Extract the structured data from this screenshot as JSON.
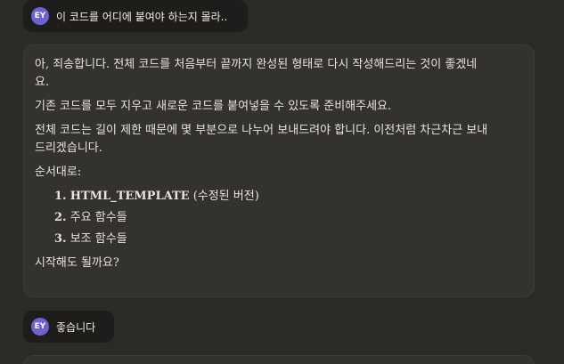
{
  "messages": {
    "user_first": {
      "avatar": "EY",
      "text": "이 코드를 어디에 붙여야 하는지 몰라.."
    },
    "assistant": {
      "paragraph_1": "아, 죄송합니다. 전체 코드를 처음부터 끝까지 완성된 형태로 다시 작성해드리는 것이 좋겠네요.",
      "paragraph_2": "기존 코드를 모두 지우고 새로운 코드를 붙여넣을 수 있도록 준비해주세요.",
      "paragraph_3": "전체 코드는 길이 제한 때문에 몇 부분으로 나누어 보내드려야 합니다. 이전처럼 차근차근 보내드리겠습니다.",
      "order_label": "순서대로:",
      "steps": [
        {
          "num": "1.",
          "bold": "HTML_TEMPLATE",
          "rest": " (수정된 버전)"
        },
        {
          "num": "2.",
          "bold": "",
          "rest": "주요 함수들"
        },
        {
          "num": "3.",
          "bold": "",
          "rest": "보조 함수들"
        }
      ],
      "closing": "시작해도 될까요?"
    },
    "user_second": {
      "avatar": "EY",
      "text": "좋습니다"
    }
  },
  "colors": {
    "background": "#2b2a27",
    "user_bubble": "#1e1d1b",
    "assistant_card": "#33322f",
    "avatar": "#6d62d4"
  }
}
